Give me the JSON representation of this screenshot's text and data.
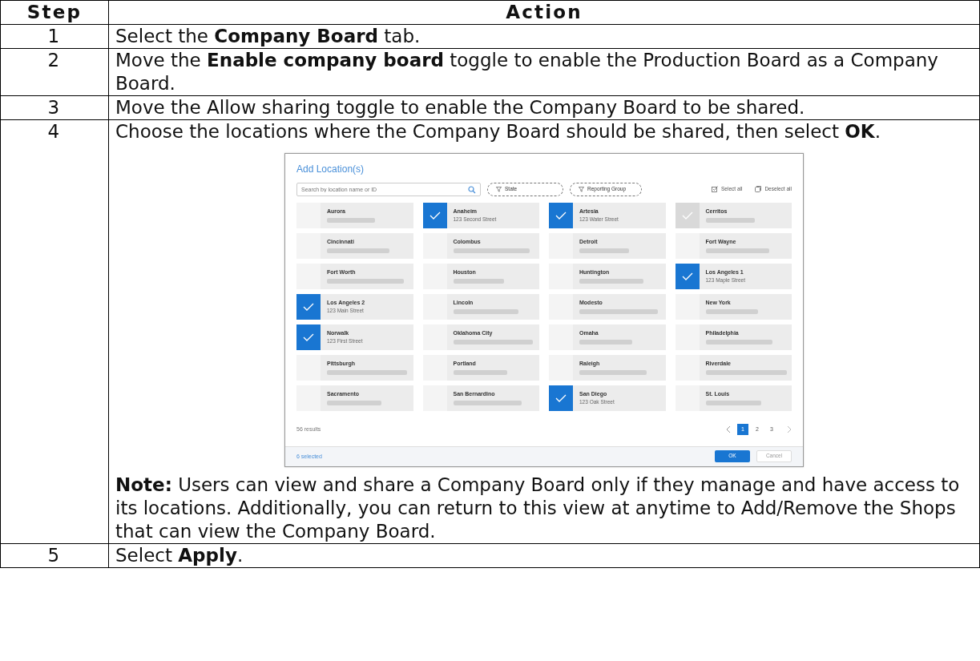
{
  "table": {
    "columns": [
      "Step",
      "Action"
    ],
    "rows": [
      {
        "step": "1",
        "action": "Select the **Company Board** tab."
      },
      {
        "step": "2",
        "action": "Move the **Enable company board** toggle to enable the Production Board as a Company Board."
      },
      {
        "step": "3",
        "action": "Move the Allow sharing toggle to enable the Company Board to be shared."
      },
      {
        "step": "4",
        "action": "Choose the locations where the Company Board should be shared, then select **OK**.",
        "dialog": {
          "title": "Add Location(s)",
          "search": {
            "placeholder": "Search by location name or ID"
          },
          "filters": [
            "State",
            "Reporting Group"
          ],
          "select_all": "Select all",
          "deselect_all": "Deselect all",
          "locations": [
            {
              "name": "Aurora",
              "checked": false,
              "disabled": false
            },
            {
              "name": "Anaheim",
              "address": "123 Second Street",
              "checked": true,
              "disabled": false
            },
            {
              "name": "Artesia",
              "address": "123 Water Street",
              "checked": true,
              "disabled": false
            },
            {
              "name": "Cerritos",
              "checked": true,
              "disabled": true
            },
            {
              "name": "Cincinnati",
              "checked": false,
              "disabled": false
            },
            {
              "name": "Colombus",
              "checked": false,
              "disabled": false
            },
            {
              "name": "Detroit",
              "checked": false,
              "disabled": false
            },
            {
              "name": "Fort Wayne",
              "checked": false,
              "disabled": false
            },
            {
              "name": "Fort Worth",
              "checked": false,
              "disabled": false
            },
            {
              "name": "Houston",
              "checked": false,
              "disabled": false
            },
            {
              "name": "Huntington",
              "checked": false,
              "disabled": false
            },
            {
              "name": "Los Angeles 1",
              "address": "123 Maple Street",
              "checked": true,
              "disabled": false
            },
            {
              "name": "Los Angeles 2",
              "address": "123 Main Street",
              "checked": true,
              "disabled": false
            },
            {
              "name": "Lincoln",
              "checked": false,
              "disabled": false
            },
            {
              "name": "Modesto",
              "checked": false,
              "disabled": false
            },
            {
              "name": "New York",
              "checked": false,
              "disabled": false
            },
            {
              "name": "Norwalk",
              "address": "123 First Street",
              "checked": true,
              "disabled": false
            },
            {
              "name": "Oklahoma City",
              "checked": false,
              "disabled": false
            },
            {
              "name": "Omaha",
              "checked": false,
              "disabled": false
            },
            {
              "name": "Philadelphia",
              "checked": false,
              "disabled": false
            },
            {
              "name": "Pittsburgh",
              "checked": false,
              "disabled": false
            },
            {
              "name": "Portland",
              "checked": false,
              "disabled": false
            },
            {
              "name": "Raleigh",
              "checked": false,
              "disabled": false
            },
            {
              "name": "Riverdale",
              "checked": false,
              "disabled": false
            },
            {
              "name": "Sacramento",
              "checked": false,
              "disabled": false
            },
            {
              "name": "San Bernardino",
              "checked": false,
              "disabled": false
            },
            {
              "name": "San Diego",
              "address": "123 Oak Street",
              "checked": true,
              "disabled": false
            },
            {
              "name": "St. Louis",
              "checked": false,
              "disabled": false
            }
          ],
          "results": "56 results",
          "pages": [
            {
              "label": "1",
              "selected": true
            },
            {
              "label": "2",
              "selected": false
            },
            {
              "label": "3",
              "selected": false
            }
          ],
          "selected_count": "6 selected",
          "ok": "OK",
          "cancel": "Cancel"
        },
        "note": "**Note:** Users can view and share a Company Board only if they manage and have access to its locations. Additionally, you can return to this view at anytime to Add/Remove the Shops that can view the Company Board."
      },
      {
        "step": "5",
        "action": "Select **Apply**."
      }
    ]
  }
}
